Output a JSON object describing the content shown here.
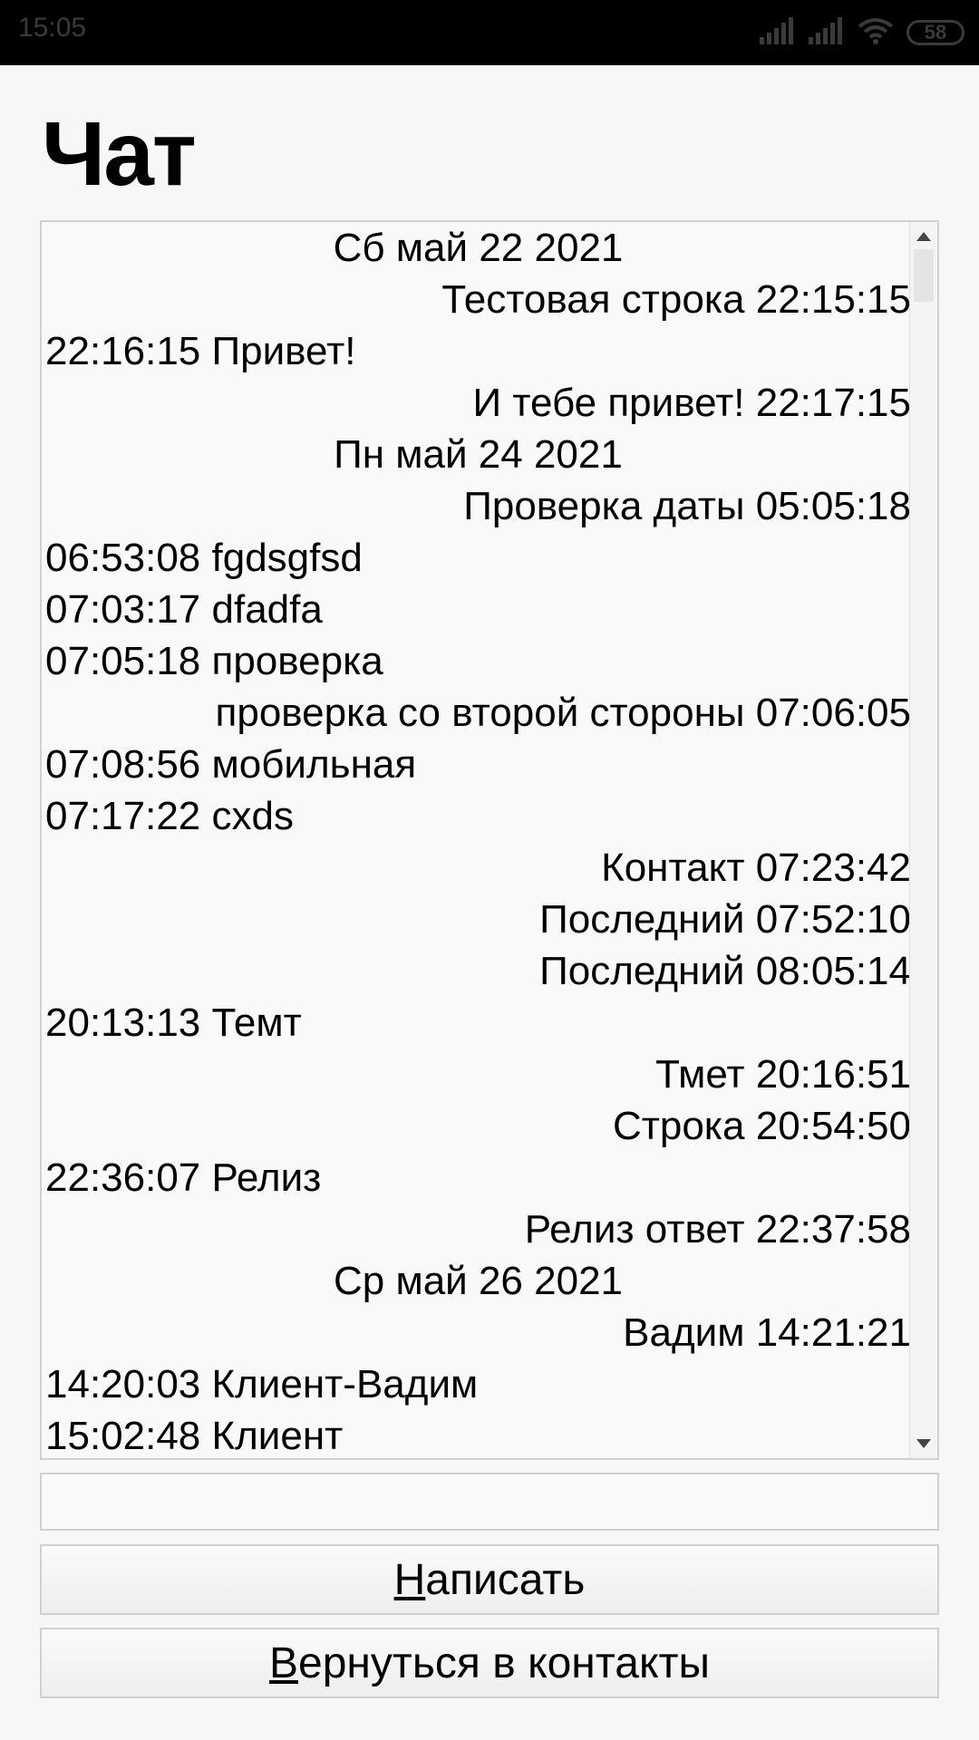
{
  "status_bar": {
    "time": "15:05",
    "battery": "58",
    "icons": [
      "signal-icon",
      "signal-icon",
      "wifi-icon",
      "battery-icon"
    ]
  },
  "title": "Чат",
  "messages": [
    {
      "type": "date",
      "text": "Сб май 22 2021"
    },
    {
      "type": "out",
      "text": "Тестовая строка 22:15:15"
    },
    {
      "type": "in",
      "text": "22:16:15 Привет!"
    },
    {
      "type": "out",
      "text": "И тебе привет! 22:17:15"
    },
    {
      "type": "date",
      "text": "Пн май 24 2021"
    },
    {
      "type": "out",
      "text": "Проверка даты 05:05:18"
    },
    {
      "type": "in",
      "text": "06:53:08 fgdsgfsd"
    },
    {
      "type": "in",
      "text": "07:03:17 dfadfa"
    },
    {
      "type": "in",
      "text": "07:05:18 проверка"
    },
    {
      "type": "out",
      "text": "проверка со второй стороны 07:06:05"
    },
    {
      "type": "in",
      "text": "07:08:56 мобильная"
    },
    {
      "type": "in",
      "text": "07:17:22 cxds"
    },
    {
      "type": "out",
      "text": "Контакт 07:23:42"
    },
    {
      "type": "out",
      "text": "Последний 07:52:10"
    },
    {
      "type": "out",
      "text": "Последний 08:05:14"
    },
    {
      "type": "in",
      "text": "20:13:13 Темт"
    },
    {
      "type": "out",
      "text": "Тмет 20:16:51"
    },
    {
      "type": "out",
      "text": "Строка 20:54:50"
    },
    {
      "type": "in",
      "text": "22:36:07 Релиз"
    },
    {
      "type": "out",
      "text": "Релиз ответ 22:37:58"
    },
    {
      "type": "date",
      "text": "Ср май 26 2021"
    },
    {
      "type": "out",
      "text": "Вадим 14:21:21"
    },
    {
      "type": "in",
      "text": "14:20:03 Клиент-Вадим"
    },
    {
      "type": "in",
      "text": "15:02:48 Клиент"
    }
  ],
  "input": {
    "value": "",
    "placeholder": ""
  },
  "buttons": {
    "send": {
      "mnemonic": "Н",
      "rest": "аписать"
    },
    "back": {
      "mnemonic": "В",
      "rest": "ернуться в контакты"
    }
  }
}
